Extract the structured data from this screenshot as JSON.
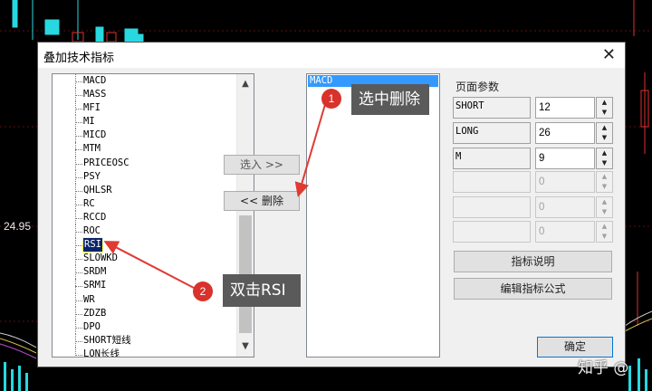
{
  "background_chart": {
    "price_label": "24.95"
  },
  "dialog": {
    "title": "叠加技术指标",
    "close_glyph": "✕",
    "indicator_list": [
      "MACD",
      "MASS",
      "MFI",
      "MI",
      "MICD",
      "MTM",
      "PRICEOSC",
      "PSY",
      "QHLSR",
      "RC",
      "RCCD",
      "ROC",
      "RSI",
      "SLOWKD",
      "SRDM",
      "SRMI",
      "WR",
      "ZDZB",
      "DPO",
      "SHORT短线",
      "LON长线"
    ],
    "selected_indicator": "RSI",
    "scroll_up_glyph": "▲",
    "scroll_down_glyph": "▼",
    "add_button": "选入 >>",
    "delete_button": "<< 删除",
    "selected_list": [
      "MACD"
    ],
    "params_title": "页面参数",
    "params": [
      {
        "name": "SHORT",
        "value": "12",
        "enabled": true
      },
      {
        "name": "LONG",
        "value": "26",
        "enabled": true
      },
      {
        "name": "M",
        "value": "9",
        "enabled": true
      },
      {
        "name": "",
        "value": "0",
        "enabled": false
      },
      {
        "name": "",
        "value": "0",
        "enabled": false
      },
      {
        "name": "",
        "value": "0",
        "enabled": false
      }
    ],
    "spin_up_glyph": "▲",
    "spin_down_glyph": "▼",
    "desc_button": "指标说明",
    "edit_button": "编辑指标公式",
    "ok_button": "确定"
  },
  "annotations": [
    {
      "number": "1",
      "text": "选中删除"
    },
    {
      "number": "2",
      "text": "双击RSI"
    }
  ],
  "watermark": "知乎 @",
  "colors": {
    "callout_bg": "#5a5a5a",
    "badge": "#d9312b",
    "arrow": "#e03a33",
    "selection": "#3399ff",
    "candle_up": "#27d8e0"
  }
}
